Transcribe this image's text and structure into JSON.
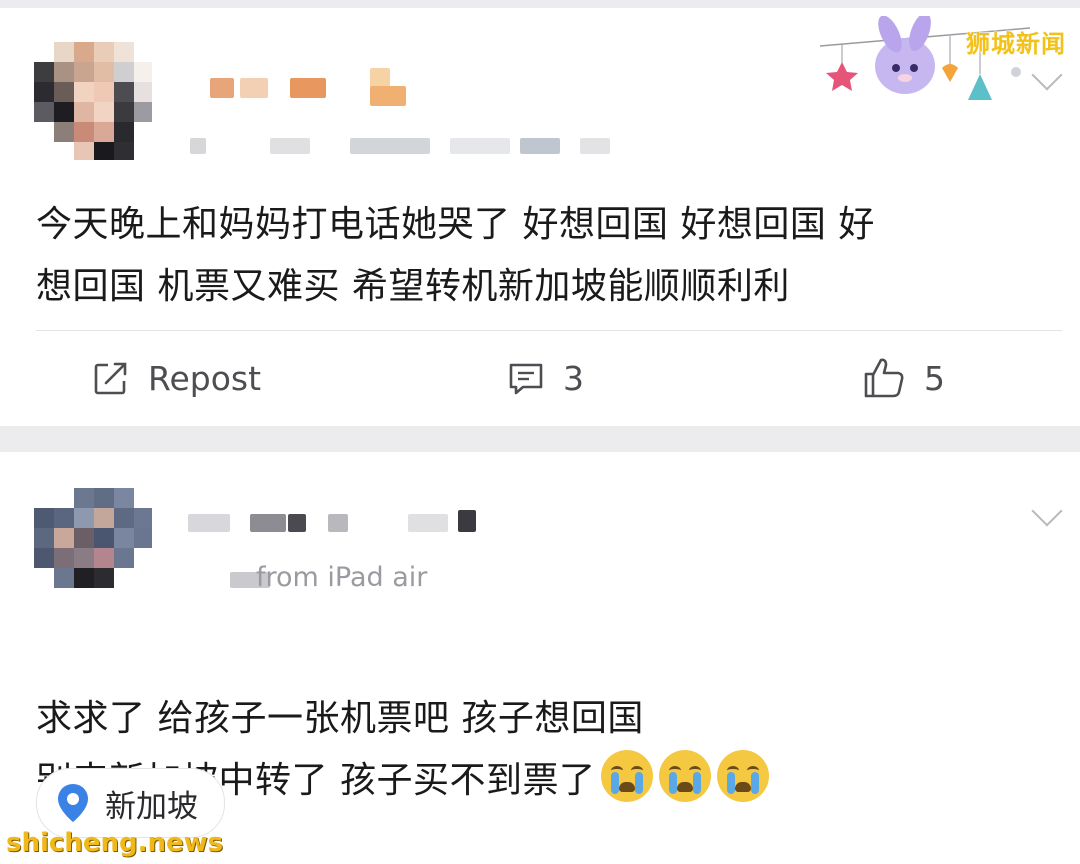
{
  "posts": [
    {
      "text": "今天晚上和妈妈打电话她哭了 好想回国 好想回国 好\n想回国 机票又难买 希望转机新加坡能顺顺利利",
      "actions": {
        "repost_label": "Repost",
        "comment_count": "3",
        "like_count": "5"
      }
    },
    {
      "source": "from iPad air",
      "text": "求求了 给孩子一张机票吧 孩子想回国\n别来新加坡中转了 孩子买不到票了",
      "location": "新加坡"
    }
  ],
  "watermarks": {
    "top_right": "狮城新闻",
    "bottom_left": "shicheng.news"
  },
  "colors": {
    "background": "#ececee",
    "card": "#ffffff",
    "location_pin": "#3b82e6",
    "watermark": "#f0b91b"
  },
  "icons": [
    "repost-icon",
    "comment-icon",
    "like-icon",
    "location-pin-icon",
    "chevron-down-icon",
    "crying-emoji"
  ]
}
